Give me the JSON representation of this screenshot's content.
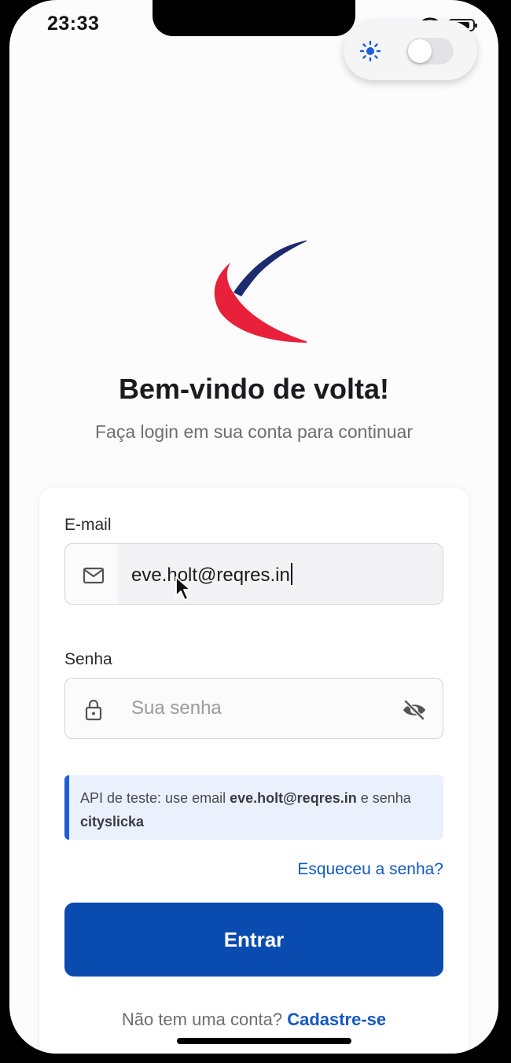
{
  "status_bar": {
    "time": "23:33",
    "battery_level": 0.9
  },
  "theme_toggle": {
    "icon": "sun-icon",
    "dark_mode_on": false,
    "accent": "#1e5ed6"
  },
  "header": {
    "title": "Bem-vindo de volta!",
    "subtitle": "Faça login em sua conta para continuar"
  },
  "login_form": {
    "email": {
      "label": "E-mail",
      "value": "eve.holt@reqres.in",
      "icon": "mail-icon"
    },
    "password": {
      "label": "Senha",
      "placeholder": "Sua senha",
      "icon": "lock-icon",
      "visibility_icon": "eye-off-icon"
    },
    "hint": {
      "prefix": "API de teste: use email ",
      "email": "eve.holt@reqres.in",
      "middle": " e senha ",
      "password": "cityslicka"
    },
    "forgot_password": "Esqueceu a senha?",
    "submit": "Entrar",
    "signup_prompt": "Não tem uma conta?",
    "signup_link": "Cadastre-se"
  },
  "colors": {
    "primary": "#0a4bb0",
    "link": "#1458c4",
    "logo_red": "#e8203a",
    "logo_navy": "#1c2a6e"
  }
}
